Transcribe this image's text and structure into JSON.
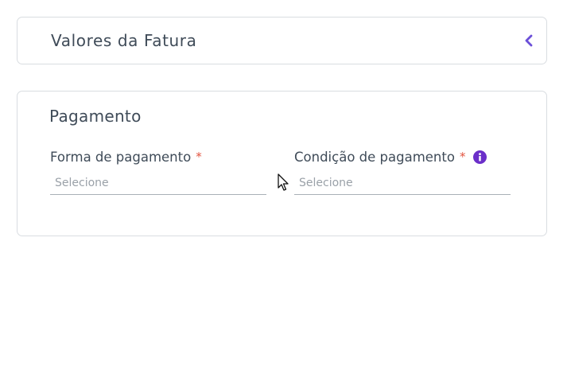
{
  "invoice_values_card": {
    "title": "Valores da Fatura",
    "toggle_icon": "chevron-left-icon",
    "accent_color": "#6b4fd8"
  },
  "payment_card": {
    "title": "Pagamento",
    "fields": [
      {
        "label": "Forma de pagamento",
        "required_mark": "*",
        "placeholder": "Selecione"
      },
      {
        "label": "Condição de pagamento",
        "required_mark": "*",
        "placeholder": "Selecione",
        "help_icon": "info-icon"
      }
    ]
  },
  "colors": {
    "required": "#e2533f",
    "info_icon": "#6b2fc9",
    "border": "#d9dde1"
  }
}
